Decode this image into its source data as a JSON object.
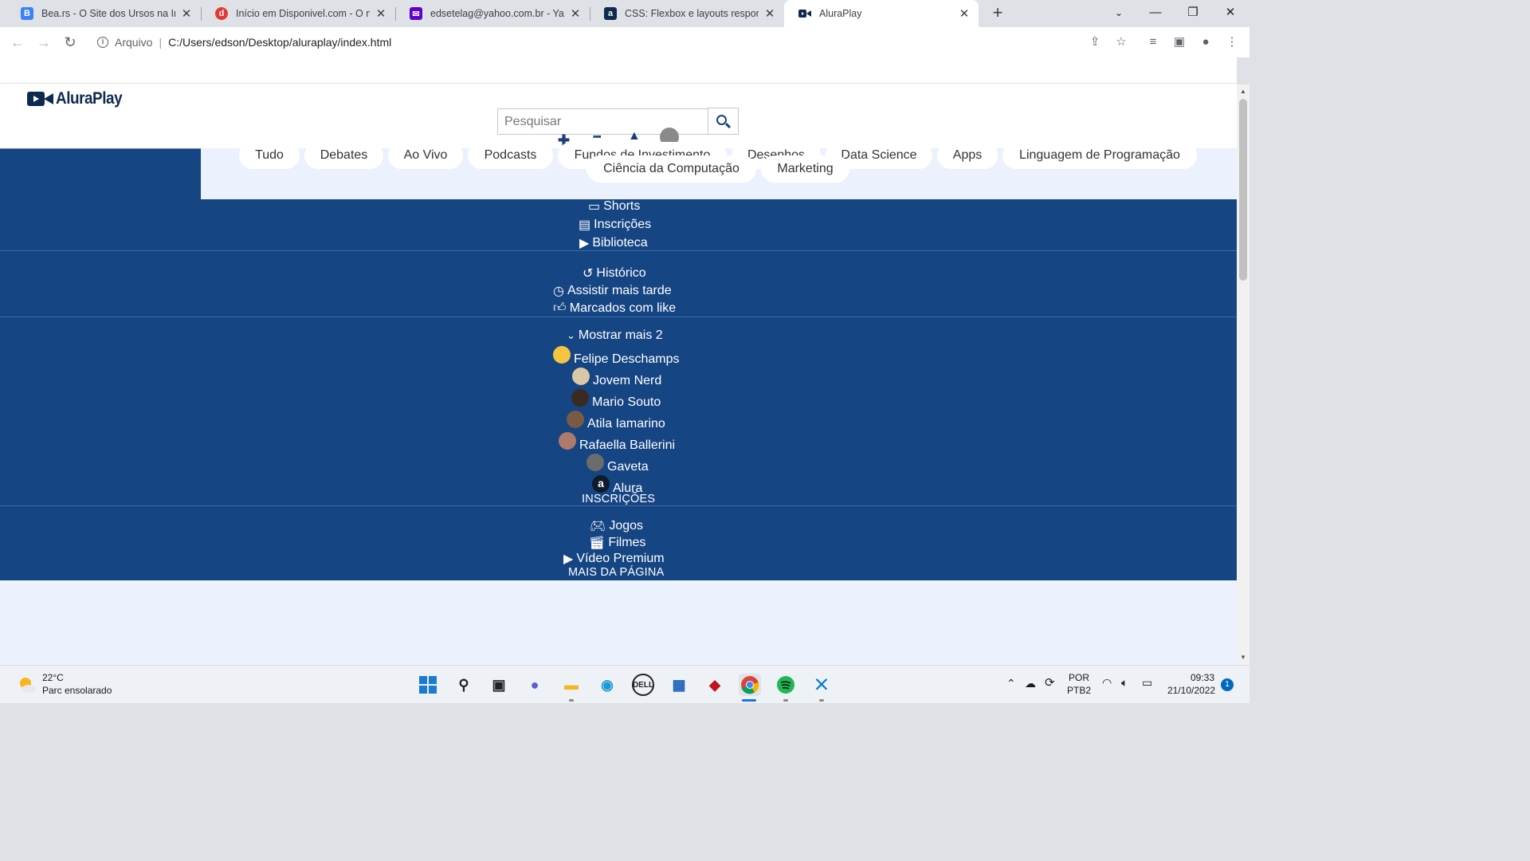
{
  "browser": {
    "tabs": [
      {
        "title": "Bea.rs - O Site dos Ursos na Inter",
        "favicon": "bears-favicon",
        "favicon_color": "#3b82f6",
        "active": false
      },
      {
        "title": "Início em Disponivel.com - O mai",
        "favicon": "disponivel-favicon",
        "favicon_color": "#e53935",
        "active": false
      },
      {
        "title": "edsetelag@yahoo.com.br - Yahoo",
        "favicon": "yahoo-mail-favicon",
        "favicon_color": "#6001d2",
        "active": false
      },
      {
        "title": "CSS: Flexbox e layouts responsivo",
        "favicon": "alura-favicon",
        "favicon_color": "#0d2a4f",
        "active": false
      },
      {
        "title": "AluraPlay",
        "favicon": "aluraplay-favicon",
        "favicon_color": "#0d2a4f",
        "active": true
      }
    ],
    "address": {
      "scheme_label": "Arquivo",
      "url": "C:/Users/edson/Desktop/aluraplay/index.html"
    }
  },
  "page": {
    "logo_text": "AluraPlay",
    "search_placeholder": "Pesquisar",
    "categories_row1": [
      "Tudo",
      "Debates",
      "Ao Vivo",
      "Podcasts",
      "Fundos de Investimento",
      "Desenhos",
      "Data Science",
      "Apps",
      "Linguagem de Programação"
    ],
    "categories_row2": [
      "Ciência da Computação",
      "Marketing"
    ],
    "menu_main": [
      {
        "label": "Shorts",
        "icon": "shorts-icon"
      },
      {
        "label": "Inscrições",
        "icon": "subscriptions-icon"
      },
      {
        "label": "Biblioteca",
        "icon": "library-icon"
      }
    ],
    "menu_history": [
      {
        "label": "Histórico",
        "icon": "history-icon"
      },
      {
        "label": "Assistir mais tarde",
        "icon": "clock-icon"
      },
      {
        "label": "Marcados com like",
        "icon": "thumbs-up-icon"
      }
    ],
    "show_more": "Mostrar mais 2",
    "channels": [
      {
        "name": "Felipe Deschamps",
        "color": "#f5c542"
      },
      {
        "name": "Jovem Nerd",
        "color": "#d9c7a6"
      },
      {
        "name": "Mario Souto",
        "color": "#3a2a20"
      },
      {
        "name": "Atila Iamarino",
        "color": "#7a5a44"
      },
      {
        "name": "Rafaella Ballerini",
        "color": "#b07a6a"
      },
      {
        "name": "Gaveta",
        "color": "#6c6c6c"
      },
      {
        "name": "Alura",
        "color": "#0d1b2a"
      }
    ],
    "subscriptions_title": "INSCRIÇÕES",
    "menu_more": [
      {
        "label": "Jogos",
        "icon": "gamepad-icon"
      },
      {
        "label": "Filmes",
        "icon": "clapperboard-icon"
      },
      {
        "label": "Vídeo Premium",
        "icon": "video-premium-icon"
      }
    ],
    "more_title": "MAIS DA PÁGINA"
  },
  "taskbar": {
    "weather_temp": "22°C",
    "weather_desc": "Parc ensolarado",
    "language": "POR",
    "layout": "PTB2",
    "time": "09:33",
    "date": "21/10/2022",
    "notification_count": "1"
  }
}
